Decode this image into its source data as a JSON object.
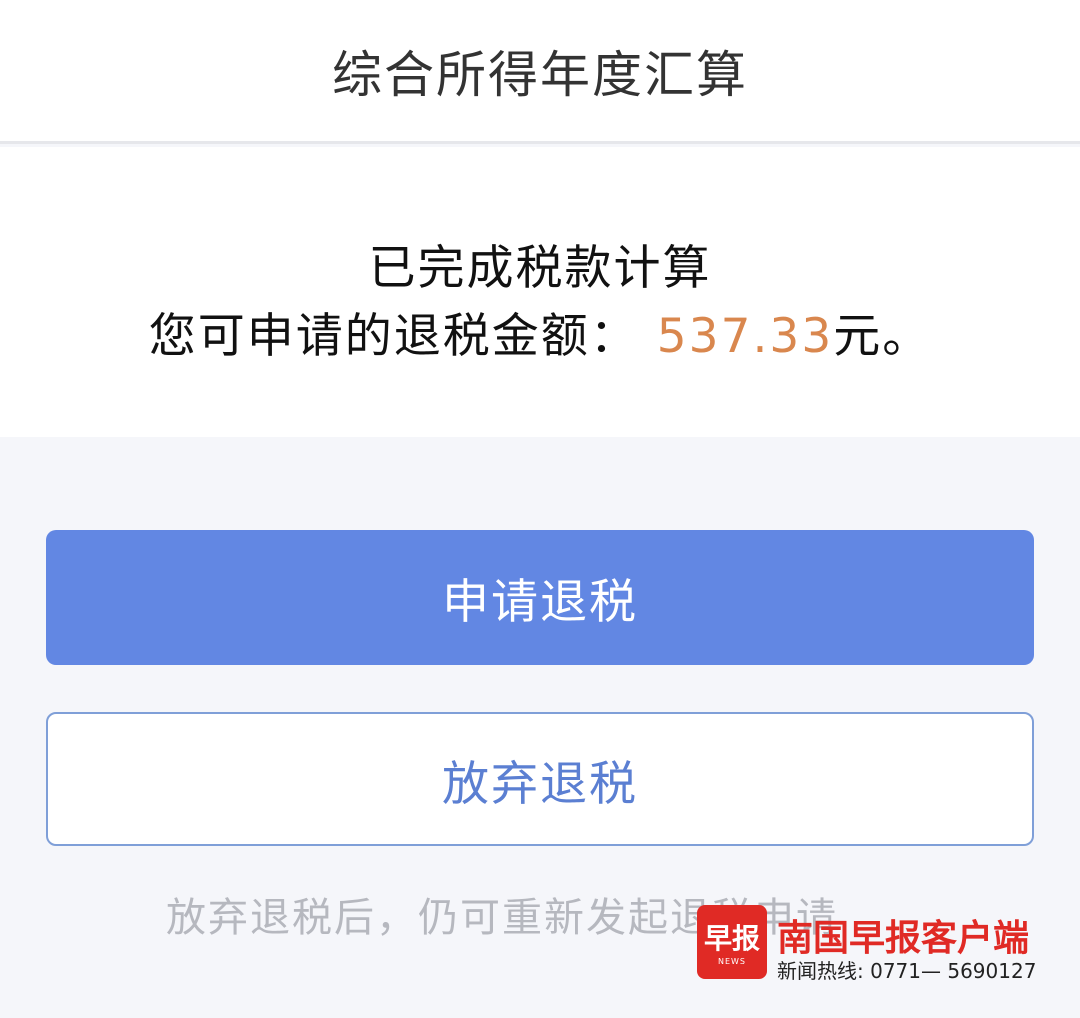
{
  "header": {
    "title": "综合所得年度汇算"
  },
  "result": {
    "status": "已完成税款计算",
    "amount_prefix": "您可申请的退税金额：",
    "amount": "537.33",
    "amount_suffix": "元。"
  },
  "actions": {
    "apply_label": "申请退税",
    "abandon_label": "放弃退税"
  },
  "hint": "放弃退税后，仍可重新发起退税申请",
  "watermark": {
    "logo_text": "早报",
    "logo_sub": "NEWS",
    "name": "南国早报客户端",
    "hotline": "新闻热线: 0771— 5690127"
  },
  "colors": {
    "primary_button": "#6287e3",
    "amount": "#d9874e",
    "outline_button_text": "#5b7fd2",
    "watermark_red": "#e02a25"
  }
}
